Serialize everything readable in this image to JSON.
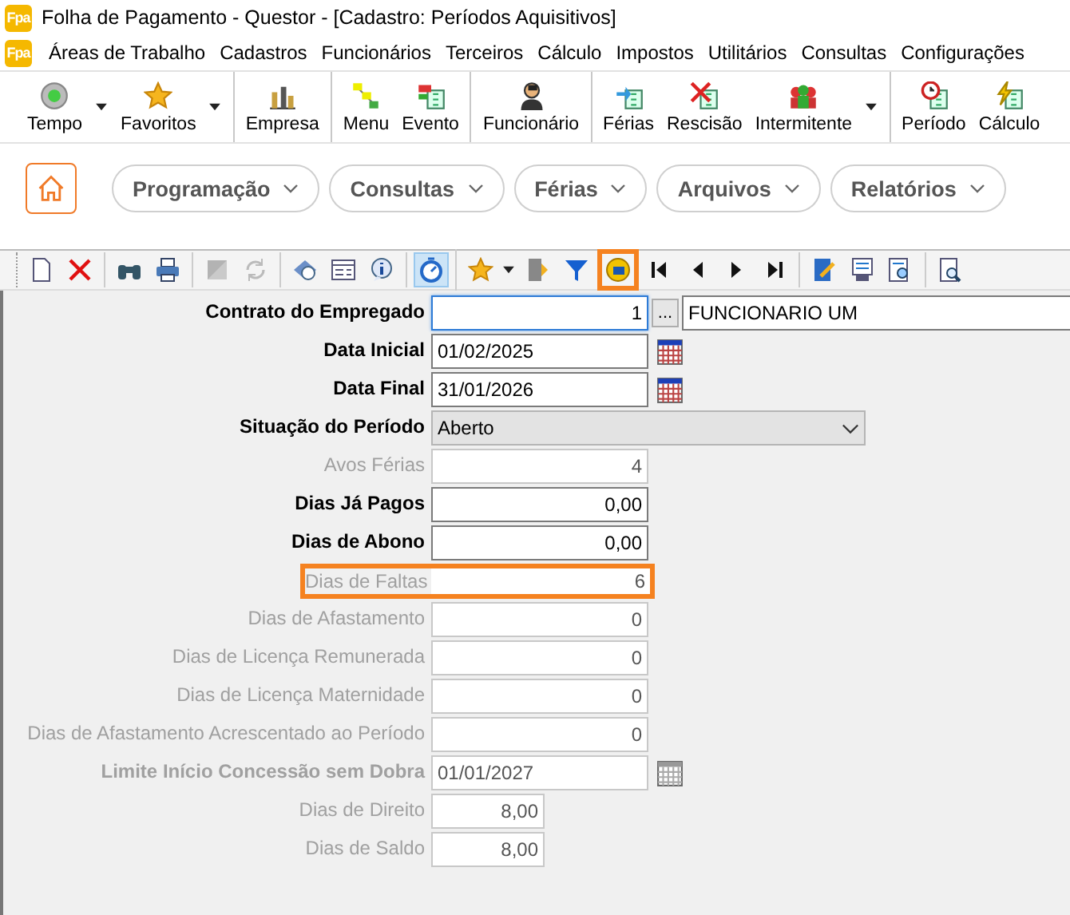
{
  "window": {
    "logo": "Fpa",
    "title": "Folha de Pagamento - Questor - [Cadastro: Períodos Aquisitivos]"
  },
  "menu": {
    "logo": "Fpa",
    "items": [
      "Áreas de Trabalho",
      "Cadastros",
      "Funcionários",
      "Terceiros",
      "Cálculo",
      "Impostos",
      "Utilitários",
      "Consultas",
      "Configurações"
    ]
  },
  "toolbar": [
    [
      {
        "label": "Tempo",
        "kind": "dropdown"
      },
      {
        "label": "Favoritos",
        "kind": "dropdown"
      }
    ],
    [
      {
        "label": "Empresa",
        "kind": "button"
      }
    ],
    [
      {
        "label": "Menu",
        "kind": "button"
      },
      {
        "label": "Evento",
        "kind": "button"
      }
    ],
    [
      {
        "label": "Funcionário",
        "kind": "button"
      }
    ],
    [
      {
        "label": "Férias",
        "kind": "button"
      },
      {
        "label": "Rescisão",
        "kind": "button"
      },
      {
        "label": "Intermitente",
        "kind": "dropdown"
      }
    ],
    [
      {
        "label": "Período",
        "kind": "button"
      },
      {
        "label": "Cálculo",
        "kind": "button"
      }
    ]
  ],
  "nav": [
    "Programação",
    "Consultas",
    "Férias",
    "Arquivos",
    "Relatórios"
  ],
  "icon_toolbar": [
    [
      {
        "kind": "button",
        "pressed": false,
        "highlighted": false,
        "disabled": false
      },
      {
        "kind": "button",
        "pressed": false,
        "highlighted": false,
        "disabled": false
      }
    ],
    [
      {
        "kind": "button",
        "pressed": false,
        "highlighted": false,
        "disabled": false
      },
      {
        "kind": "button",
        "pressed": false,
        "highlighted": false,
        "disabled": false
      }
    ],
    [
      {
        "kind": "button",
        "pressed": false,
        "highlighted": false,
        "disabled": true
      },
      {
        "kind": "button",
        "pressed": false,
        "highlighted": false,
        "disabled": true
      }
    ],
    [
      {
        "kind": "button",
        "pressed": false,
        "highlighted": false,
        "disabled": false
      },
      {
        "kind": "button",
        "pressed": false,
        "highlighted": false,
        "disabled": false
      },
      {
        "kind": "button",
        "pressed": false,
        "highlighted": false,
        "disabled": false
      }
    ],
    [
      {
        "kind": "button",
        "pressed": true,
        "highlighted": false,
        "disabled": false
      }
    ],
    [
      {
        "kind": "dropdown",
        "pressed": false,
        "highlighted": false,
        "disabled": false
      },
      {
        "kind": "button",
        "pressed": false,
        "highlighted": false,
        "disabled": false
      },
      {
        "kind": "button",
        "pressed": false,
        "highlighted": false,
        "disabled": false
      },
      {
        "kind": "button",
        "pressed": false,
        "highlighted": true,
        "disabled": false
      },
      {
        "kind": "button",
        "pressed": false,
        "highlighted": false,
        "disabled": false
      },
      {
        "kind": "button",
        "pressed": false,
        "highlighted": false,
        "disabled": false
      },
      {
        "kind": "button",
        "pressed": false,
        "highlighted": false,
        "disabled": false
      },
      {
        "kind": "button",
        "pressed": false,
        "highlighted": false,
        "disabled": false
      }
    ],
    [
      {
        "kind": "button",
        "pressed": false,
        "highlighted": false,
        "disabled": false
      },
      {
        "kind": "button",
        "pressed": false,
        "highlighted": false,
        "disabled": false
      },
      {
        "kind": "button",
        "pressed": false,
        "highlighted": false,
        "disabled": false
      }
    ],
    [
      {
        "kind": "button",
        "pressed": false,
        "highlighted": false,
        "disabled": false
      }
    ]
  ],
  "form": [
    {
      "label": "Contrato do Empregado",
      "kind": "lookup",
      "value": "1",
      "name": "FUNCIONARIO UM",
      "button": "...",
      "bold": true,
      "disabled": false,
      "highlighted": false,
      "focused": true
    },
    {
      "label": "Data Inicial",
      "kind": "date",
      "value": "01/02/2025",
      "bold": true,
      "disabled": false,
      "highlighted": false,
      "focused": false
    },
    {
      "label": "Data Final",
      "kind": "date",
      "value": "31/01/2026",
      "bold": true,
      "disabled": false,
      "highlighted": false,
      "focused": false
    },
    {
      "label": "Situação do Período",
      "kind": "select",
      "value": "Aberto",
      "bold": true,
      "disabled": false,
      "highlighted": false,
      "focused": false
    },
    {
      "label": "Avos Férias",
      "kind": "number",
      "value": "4",
      "bold": false,
      "disabled": true,
      "highlighted": false,
      "focused": false
    },
    {
      "label": "Dias Já Pagos",
      "kind": "number",
      "value": "0,00",
      "bold": true,
      "disabled": false,
      "highlighted": false,
      "focused": false
    },
    {
      "label": "Dias de Abono",
      "kind": "number",
      "value": "0,00",
      "bold": true,
      "disabled": false,
      "highlighted": false,
      "focused": false
    },
    {
      "label": "Dias de Faltas",
      "kind": "number",
      "value": "6",
      "bold": false,
      "disabled": true,
      "highlighted": true,
      "focused": false
    },
    {
      "label": "Dias de Afastamento",
      "kind": "number",
      "value": "0",
      "bold": false,
      "disabled": true,
      "highlighted": false,
      "focused": false
    },
    {
      "label": "Dias de Licença Remunerada",
      "kind": "number",
      "value": "0",
      "bold": false,
      "disabled": true,
      "highlighted": false,
      "focused": false
    },
    {
      "label": "Dias de Licença Maternidade",
      "kind": "number",
      "value": "0",
      "bold": false,
      "disabled": true,
      "highlighted": false,
      "focused": false
    },
    {
      "label": "Dias de Afastamento Acrescentado ao Período",
      "kind": "number",
      "value": "0",
      "bold": false,
      "disabled": true,
      "highlighted": false,
      "focused": false
    },
    {
      "label": "Limite Início Concessão sem Dobra",
      "kind": "date",
      "value": "01/01/2027",
      "bold": true,
      "disabled": true,
      "highlighted": false,
      "focused": false
    },
    {
      "label": "Dias de Direito",
      "kind": "short",
      "value": "8,00",
      "bold": false,
      "disabled": true,
      "highlighted": false,
      "focused": false
    },
    {
      "label": "Dias de Saldo",
      "kind": "short",
      "value": "8,00",
      "bold": false,
      "disabled": true,
      "highlighted": false,
      "focused": false
    }
  ]
}
